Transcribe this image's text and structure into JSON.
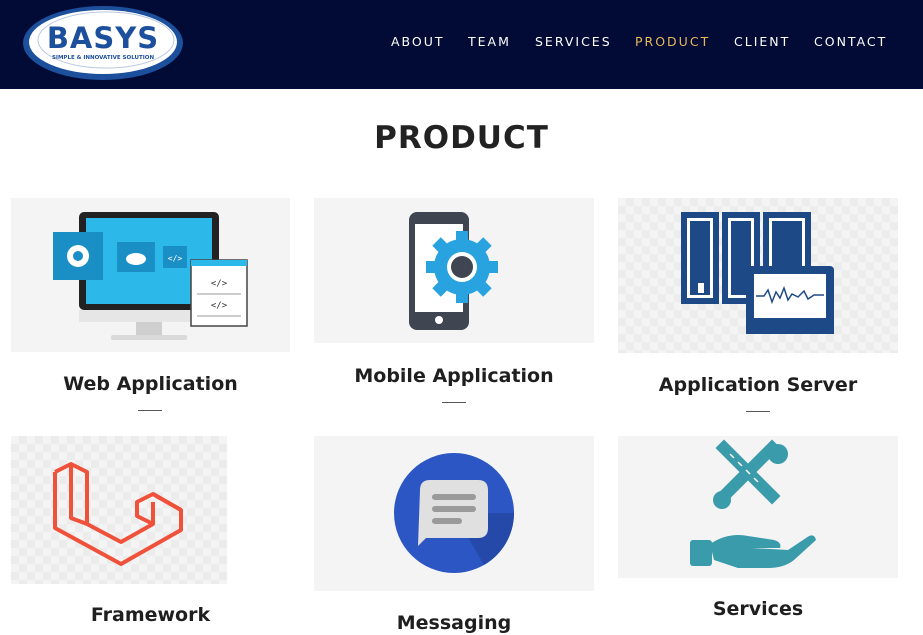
{
  "brand": {
    "name": "BASYS",
    "tagline": "SIMPLE & INNOVATIVE SOLUTION"
  },
  "nav": {
    "items": [
      {
        "label": "ABOUT",
        "active": false
      },
      {
        "label": "TEAM",
        "active": false
      },
      {
        "label": "SERVICES",
        "active": false
      },
      {
        "label": "PRODUCT",
        "active": true
      },
      {
        "label": "CLIENT",
        "active": false
      },
      {
        "label": "CONTACT",
        "active": false
      }
    ]
  },
  "page": {
    "title": "PRODUCT"
  },
  "products": [
    {
      "title": "Web Application",
      "icon": "web-application-icon"
    },
    {
      "title": "Mobile Application",
      "icon": "mobile-gear-icon"
    },
    {
      "title": "Application Server",
      "icon": "server-monitor-icon"
    },
    {
      "title": "Framework",
      "icon": "laravel-framework-icon"
    },
    {
      "title": "Messaging",
      "icon": "messaging-icon"
    },
    {
      "title": "Services",
      "icon": "tools-hand-icon"
    }
  ],
  "colors": {
    "header_bg": "#020b35",
    "nav_active": "#e8b85a",
    "nav_text": "#ffffff",
    "logo_blue": "#1c4f9c"
  }
}
